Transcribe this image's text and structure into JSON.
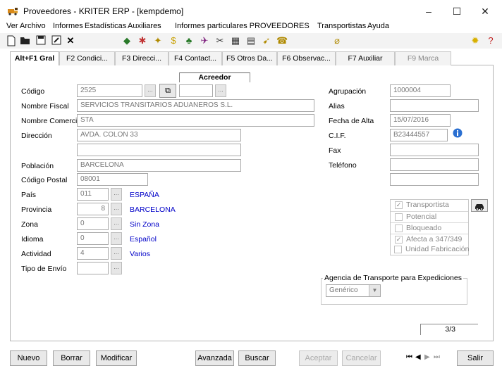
{
  "window": {
    "title": "Proveedores - KRITER ERP - [kempdemo]",
    "minimize": "–",
    "maximize": "☐",
    "close": "✕"
  },
  "menu": [
    "Ver",
    "Archivo",
    "Informes",
    "Estadísticas",
    "Auxiliares",
    "Informes particulares PROVEEDORES",
    "Transportistas",
    "Ayuda"
  ],
  "tabs": [
    "Alt+F1 Gral",
    "F2 Condici...",
    "F3 Direcci...",
    "F4 Contact...",
    "F5 Otros Da...",
    "F6 Observac...",
    "F7 Auxiliar",
    "F9 Marca"
  ],
  "form": {
    "acreedor_label": "Acreedor",
    "codigo_label": "Código",
    "codigo": "2525",
    "nombre_fiscal_label": "Nombre Fiscal",
    "nombre_fiscal": "SERVICIOS TRANSITARIOS ADUANEROS S.L.",
    "nombre_comercial_label": "Nombre Comercial",
    "nombre_comercial": "STA",
    "direccion_label": "Dirección",
    "direccion": "AVDA. COLON 33",
    "direccion2": "",
    "poblacion_label": "Población",
    "poblacion": "BARCELONA",
    "codigo_postal_label": "Código Postal",
    "codigo_postal": "08001",
    "pais_label": "País",
    "pais_code": "011",
    "pais_name": "ESPAÑA",
    "provincia_label": "Provincia",
    "provincia_code": "8",
    "provincia_name": "BARCELONA",
    "zona_label": "Zona",
    "zona_code": "0",
    "zona_name": "Sin Zona",
    "idioma_label": "Idioma",
    "idioma_code": "0",
    "idioma_name": "Español",
    "actividad_label": "Actividad",
    "actividad_code": "4",
    "actividad_name": "Varios",
    "tipo_envio_label": "Tipo de Envío",
    "tipo_envio": "",
    "agrupacion_label": "Agrupación",
    "agrupacion": "1000004",
    "alias_label": "Alias",
    "alias": "",
    "fecha_alta_label": "Fecha de Alta",
    "fecha_alta": "15/07/2016",
    "cif_label": "C.I.F.",
    "cif": "B23444557",
    "fax_label": "Fax",
    "fax": "",
    "telefono_label": "Teléfono",
    "telefono": "",
    "telefono2": ""
  },
  "checks": [
    {
      "label": "Transportista",
      "checked": true
    },
    {
      "label": "Potencial",
      "checked": false
    },
    {
      "label": "Bloqueado",
      "checked": false
    },
    {
      "label": "Afecta a 347/349",
      "checked": true
    },
    {
      "label": "Unidad Fabricación",
      "checked": false
    }
  ],
  "agencia": {
    "label": "Agencia de Transporte para Expediciones",
    "value": "Genérico"
  },
  "record_counter": "3/3",
  "buttons": {
    "nuevo": "Nuevo",
    "borrar": "Borrar",
    "modificar": "Modificar",
    "avanzada": "Avanzada",
    "buscar": "Buscar",
    "aceptar": "Aceptar",
    "cancelar": "Cancelar",
    "salir": "Salir"
  },
  "icons": {
    "app": "provider-truck-icon",
    "info": "info-icon",
    "car": "car-icon",
    "copy": "copy-icon"
  },
  "colors": {
    "link": "#0000c8",
    "disabled_text": "#aaaaaa",
    "info": "#2a6fd1"
  }
}
